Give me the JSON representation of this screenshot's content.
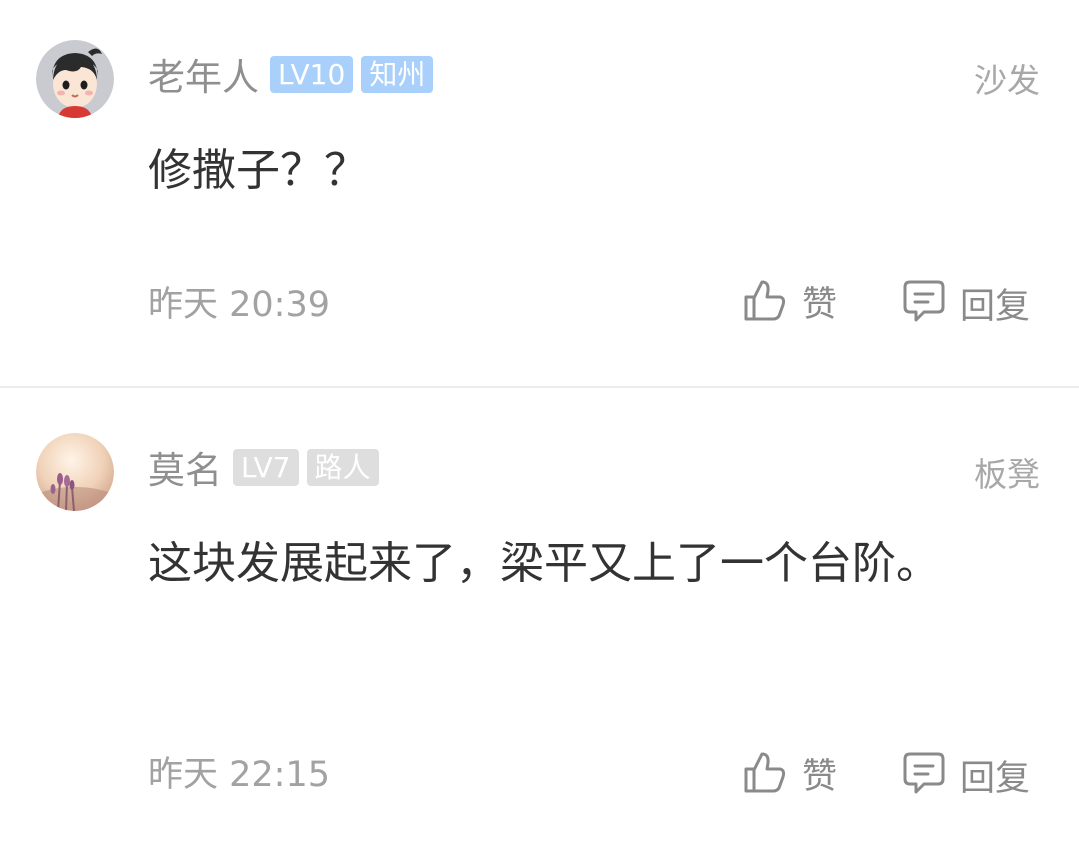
{
  "comments": [
    {
      "username": "老年人",
      "level_badge": "LV10",
      "title_badge": "知州",
      "floor": "沙发",
      "content": "修撒子？？",
      "time": "昨天 20:39",
      "like_label": "赞",
      "reply_label": "回复",
      "badge_color": "#a9d0fb"
    },
    {
      "username": "莫名",
      "level_badge": "LV7",
      "title_badge": "路人",
      "floor": "板凳",
      "content": "这块发展起来了，梁平又上了一个台阶。",
      "time": "昨天 22:15",
      "like_label": "赞",
      "reply_label": "回复",
      "badge_color": "#dedede"
    }
  ],
  "icons": {
    "like": "thumbs-up-icon",
    "reply": "comment-bubble-icon"
  }
}
